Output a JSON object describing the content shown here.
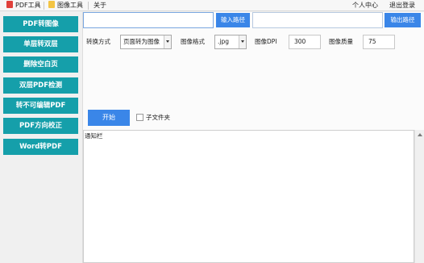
{
  "menubar": {
    "tabs": [
      {
        "label": "PDF工具",
        "icon": "pdf-file-icon",
        "color": "#e0403a"
      },
      {
        "label": "图像工具",
        "icon": "image-folder-icon",
        "color": "#f3c443"
      },
      {
        "label": "关于"
      }
    ],
    "user_center": "个人中心",
    "logout": "退出登录"
  },
  "sidebar": {
    "items": [
      {
        "label": "PDF转图像"
      },
      {
        "label": "单层转双层"
      },
      {
        "label": "删除空白页"
      },
      {
        "label": "双层PDF检测"
      },
      {
        "label": "转不可编辑PDF"
      },
      {
        "label": "PDF方向校正"
      },
      {
        "label": "Word转PDF"
      }
    ],
    "accent": "#159faa"
  },
  "main": {
    "input_path": {
      "value": "",
      "button": "输入路径"
    },
    "output_path": {
      "value": "",
      "button": "输出路径"
    },
    "convert_mode": {
      "label": "转换方式",
      "value": "页面转为图像"
    },
    "image_format": {
      "label": "图像格式",
      "value": ".jpg"
    },
    "image_dpi": {
      "label": "图像DPI",
      "value": "300"
    },
    "image_quality": {
      "label": "图像质量",
      "value": "75"
    },
    "start_button": "开始",
    "subfolder": {
      "label": "子文件夹",
      "checked": false
    },
    "notify_label": "通知栏",
    "button_color": "#3a86e8"
  }
}
